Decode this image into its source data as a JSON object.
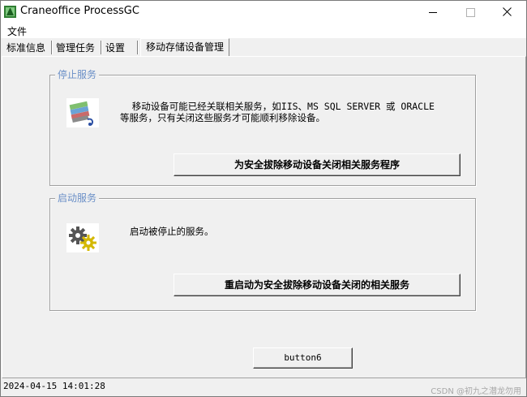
{
  "window": {
    "title": "Craneoffice ProcessGC",
    "minimize_icon": "minimize-icon",
    "maximize_icon": "maximize-icon",
    "close_icon": "close-icon"
  },
  "menu": {
    "file": "文件"
  },
  "tabs": [
    {
      "label": "标准信息",
      "active": false
    },
    {
      "label": "管理任务",
      "active": false
    },
    {
      "label": "设置",
      "active": false
    },
    {
      "label": "移动存储设备管理",
      "active": true
    }
  ],
  "stop_group": {
    "legend": "停止服务",
    "icon": "usb-device-icon",
    "line1": "   移动设备可能已经关联相关服务，如IIS、MS SQL SERVER 或 ORACLE",
    "line2": "等服务，只有关闭这些服务才可能顺利移除设备。",
    "button": "为安全拔除移动设备关闭相关服务程序"
  },
  "start_group": {
    "legend": "启动服务",
    "icon": "gears-icon",
    "text": "启动被停止的服务。",
    "button": "重启动为安全拔除移动设备关闭的相关服务"
  },
  "footer_button": "button6",
  "status_time": "2024-04-15 14:01:28",
  "watermark": "CSDN @初九之潜龙勿用",
  "colors": {
    "legend": "#6a8fc7",
    "background": "#f0f0f0"
  }
}
